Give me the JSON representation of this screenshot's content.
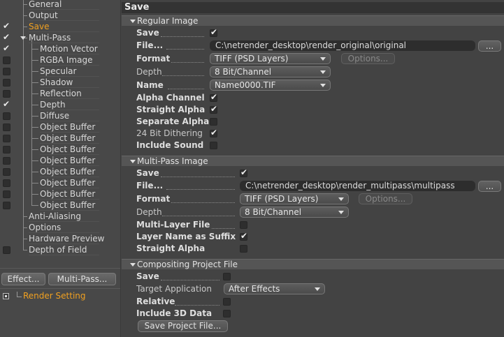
{
  "tree": {
    "items": [
      {
        "label": "General",
        "checked": null
      },
      {
        "label": "Output",
        "checked": null
      },
      {
        "label": "Save",
        "checked": true,
        "active": true
      },
      {
        "label": "Multi-Pass",
        "checked": true
      },
      {
        "label": "Motion Vector",
        "checked": true
      },
      {
        "label": "RGBA Image",
        "checked": false
      },
      {
        "label": "Specular",
        "checked": false
      },
      {
        "label": "Shadow",
        "checked": false
      },
      {
        "label": "Reflection",
        "checked": false
      },
      {
        "label": "Depth",
        "checked": true
      },
      {
        "label": "Diffuse",
        "checked": false
      },
      {
        "label": "Object Buffer",
        "checked": false
      },
      {
        "label": "Object Buffer",
        "checked": false
      },
      {
        "label": "Object Buffer",
        "checked": false
      },
      {
        "label": "Object Buffer",
        "checked": false
      },
      {
        "label": "Object Buffer",
        "checked": false
      },
      {
        "label": "Object Buffer",
        "checked": false
      },
      {
        "label": "Object Buffer",
        "checked": false
      },
      {
        "label": "Object Buffer",
        "checked": false
      },
      {
        "label": "Anti-Aliasing",
        "checked": null
      },
      {
        "label": "Options",
        "checked": null
      },
      {
        "label": "Hardware Preview",
        "checked": null
      },
      {
        "label": "Depth of Field",
        "checked": false
      }
    ],
    "effect_button": "Effect...",
    "multipass_button": "Multi-Pass...",
    "render_setting": "Render Setting"
  },
  "panel_title": "Save",
  "regular": {
    "header": "Regular Image",
    "save_label": "Save",
    "file_label": "File...",
    "file_path": "C:\\netrender_desktop\\render_original\\original",
    "browse": "...",
    "format_label": "Format",
    "format_value": "TIFF (PSD Layers)",
    "options": "Options...",
    "depth_label": "Depth",
    "depth_value": "8 Bit/Channel",
    "name_label": "Name",
    "name_value": "Name0000.TIF",
    "alpha_label": "Alpha Channel",
    "straight_label": "Straight Alpha",
    "separate_label": "Separate Alpha",
    "dither_label": "24 Bit Dithering",
    "sound_label": "Include Sound"
  },
  "multipass": {
    "header": "Multi-Pass Image",
    "save_label": "Save",
    "file_label": "File...",
    "file_path": "C:\\netrender_desktop\\render_multipass\\multipass",
    "browse": "...",
    "format_label": "Format",
    "format_value": "TIFF (PSD Layers)",
    "options": "Options...",
    "depth_label": "Depth",
    "depth_value": "8 Bit/Channel",
    "multilayer_label": "Multi-Layer File",
    "suffix_label": "Layer Name as Suffix",
    "straight_label": "Straight Alpha"
  },
  "compositing": {
    "header": "Compositing Project File",
    "save_label": "Save",
    "target_label": "Target Application",
    "target_value": "After Effects",
    "relative_label": "Relative",
    "include3d_label": "Include 3D Data",
    "save_button": "Save Project File..."
  }
}
